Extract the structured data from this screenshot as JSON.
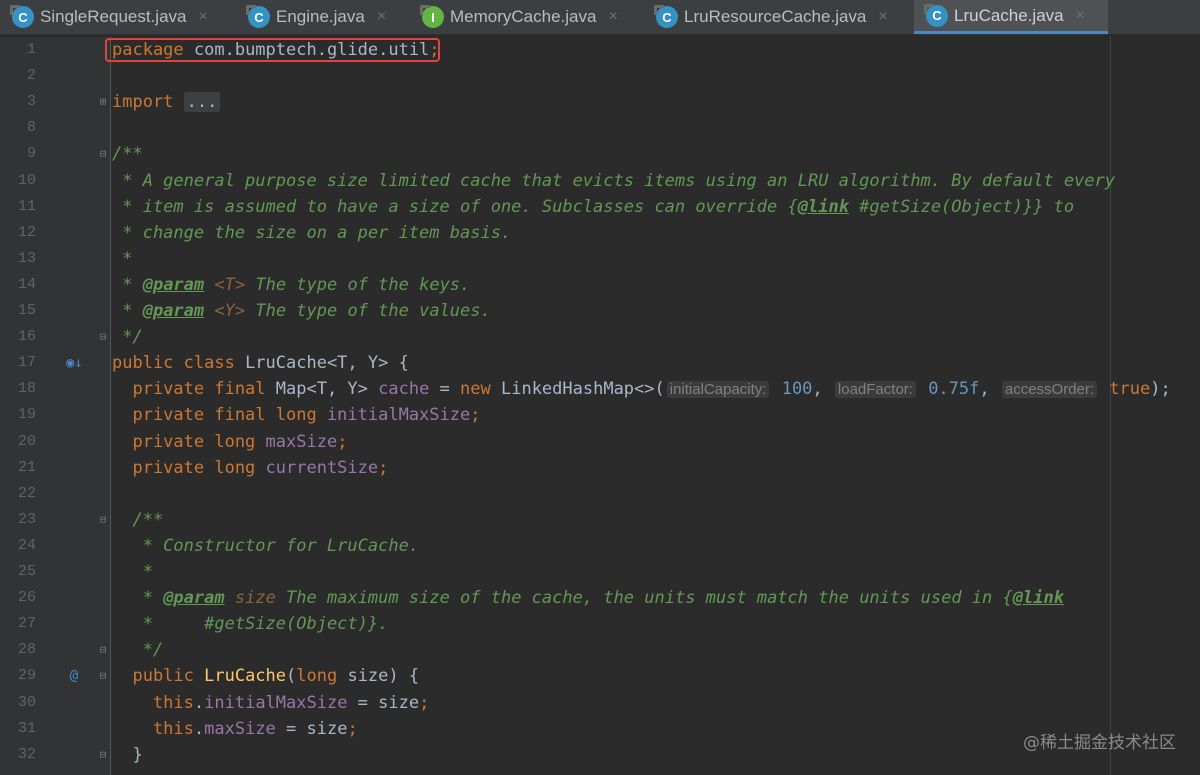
{
  "tabs": [
    {
      "label": "SingleRequest.java",
      "icon": "class-c-icon",
      "badge": "C",
      "active": false
    },
    {
      "label": "Engine.java",
      "icon": "class-c-icon",
      "badge": "C",
      "active": false
    },
    {
      "label": "MemoryCache.java",
      "icon": "interface-i-icon",
      "badge": "I",
      "active": false
    },
    {
      "label": "LruResourceCache.java",
      "icon": "class-c-icon",
      "badge": "C",
      "active": false
    },
    {
      "label": "LruCache.java",
      "icon": "class-c-icon",
      "badge": "C",
      "active": true
    }
  ],
  "close_glyph": "×",
  "editor": {
    "lines": [
      {
        "n": "1",
        "tokens": [
          [
            "kw",
            "package"
          ],
          [
            "id",
            " com.bumptech.glide.util"
          ],
          [
            "kw",
            ";"
          ]
        ]
      },
      {
        "n": "2",
        "tokens": []
      },
      {
        "n": "3",
        "fold": "⊞",
        "tokens": [
          [
            "kw",
            "import"
          ],
          [
            "id",
            " "
          ],
          [
            "folded",
            "..."
          ]
        ]
      },
      {
        "n": "8",
        "tokens": []
      },
      {
        "n": "9",
        "fold": "⊟",
        "tokens": [
          [
            "doc",
            "/**"
          ]
        ]
      },
      {
        "n": "10",
        "tokens": [
          [
            "doc",
            " * A general purpose size limited cache that evicts items using an LRU algorithm. By default every"
          ]
        ]
      },
      {
        "n": "11",
        "tokens": [
          [
            "doc",
            " * item is assumed to have a size of one. Subclasses can override {"
          ],
          [
            "tag",
            "@link"
          ],
          [
            "doc",
            " #getSize("
          ],
          [
            "docref",
            "Object"
          ],
          [
            "doc",
            ")}} to"
          ]
        ]
      },
      {
        "n": "12",
        "tokens": [
          [
            "doc",
            " * change the size on a per item basis."
          ]
        ]
      },
      {
        "n": "13",
        "tokens": [
          [
            "doc",
            " *"
          ]
        ]
      },
      {
        "n": "14",
        "tokens": [
          [
            "doc",
            " * "
          ],
          [
            "tag",
            "@param"
          ],
          [
            "doc",
            " "
          ],
          [
            "tparam",
            "<T>"
          ],
          [
            "doc",
            " The type of the keys."
          ]
        ]
      },
      {
        "n": "15",
        "tokens": [
          [
            "doc",
            " * "
          ],
          [
            "tag",
            "@param"
          ],
          [
            "doc",
            " "
          ],
          [
            "tparam",
            "<Y>"
          ],
          [
            "doc",
            " The type of the values."
          ]
        ]
      },
      {
        "n": "16",
        "fold": "⊟",
        "tokens": [
          [
            "doc",
            " */"
          ]
        ]
      },
      {
        "n": "17",
        "gutter": "◉↓",
        "gutter_name": "implemented-by-icon",
        "tokens": [
          [
            "kw",
            "public class "
          ],
          [
            "id",
            "LruCache<T, Y> {"
          ]
        ]
      },
      {
        "n": "18",
        "tokens": [
          [
            "kw",
            "  private final "
          ],
          [
            "id",
            "Map<T, Y> "
          ],
          [
            "field",
            "cache"
          ],
          [
            "id",
            " = "
          ],
          [
            "kw",
            "new "
          ],
          [
            "id",
            "LinkedHashMap<>("
          ],
          [
            "hint",
            "initialCapacity:"
          ],
          [
            "num",
            " 100"
          ],
          [
            "id",
            ", "
          ],
          [
            "hint",
            "loadFactor:"
          ],
          [
            "num",
            " 0.75f"
          ],
          [
            "id",
            ", "
          ],
          [
            "hint",
            "accessOrder:"
          ],
          [
            "kw",
            " true"
          ],
          [
            "id",
            ");"
          ]
        ]
      },
      {
        "n": "19",
        "tokens": [
          [
            "kw",
            "  private final long "
          ],
          [
            "field",
            "initialMaxSize"
          ],
          [
            "kw",
            ";"
          ]
        ]
      },
      {
        "n": "20",
        "tokens": [
          [
            "kw",
            "  private long "
          ],
          [
            "field",
            "maxSize"
          ],
          [
            "kw",
            ";"
          ]
        ]
      },
      {
        "n": "21",
        "tokens": [
          [
            "kw",
            "  private long "
          ],
          [
            "field",
            "currentSize"
          ],
          [
            "kw",
            ";"
          ]
        ]
      },
      {
        "n": "22",
        "tokens": []
      },
      {
        "n": "23",
        "fold": "⊟",
        "tokens": [
          [
            "doc",
            "  /**"
          ]
        ]
      },
      {
        "n": "24",
        "tokens": [
          [
            "doc",
            "   * Constructor for LruCache."
          ]
        ]
      },
      {
        "n": "25",
        "tokens": [
          [
            "doc",
            "   *"
          ]
        ]
      },
      {
        "n": "26",
        "tokens": [
          [
            "doc",
            "   * "
          ],
          [
            "tag",
            "@param"
          ],
          [
            "doc",
            " "
          ],
          [
            "tparam",
            "size"
          ],
          [
            "doc",
            " The maximum size of the cache, the units must match the units used in {"
          ],
          [
            "tag",
            "@link"
          ]
        ]
      },
      {
        "n": "27",
        "tokens": [
          [
            "doc",
            "   *     #getSize("
          ],
          [
            "docref",
            "Object"
          ],
          [
            "doc",
            ")}."
          ]
        ]
      },
      {
        "n": "28",
        "fold": "⊟",
        "tokens": [
          [
            "doc",
            "   */"
          ]
        ]
      },
      {
        "n": "29",
        "gutter": "@",
        "gutter_name": "annotation-icon",
        "fold": "⊟",
        "tokens": [
          [
            "kw",
            "  public "
          ],
          [
            "fn",
            "LruCache"
          ],
          [
            "id",
            "("
          ],
          [
            "kw",
            "long "
          ],
          [
            "id",
            "size) {"
          ]
        ]
      },
      {
        "n": "30",
        "tokens": [
          [
            "kw",
            "    this"
          ],
          [
            "id",
            "."
          ],
          [
            "field",
            "initialMaxSize"
          ],
          [
            "id",
            " = size"
          ],
          [
            "kw",
            ";"
          ]
        ]
      },
      {
        "n": "31",
        "tokens": [
          [
            "kw",
            "    this"
          ],
          [
            "id",
            "."
          ],
          [
            "field",
            "maxSize"
          ],
          [
            "id",
            " = size"
          ],
          [
            "kw",
            ";"
          ]
        ]
      },
      {
        "n": "32",
        "fold": "⊟",
        "tokens": [
          [
            "id",
            "  }"
          ]
        ]
      }
    ]
  },
  "watermark": "@稀土掘金技术社区",
  "colors": {
    "background": "#2b2b2b",
    "keyword": "#cc7832",
    "doc_comment": "#629755",
    "field": "#9876aa",
    "number": "#6897bb",
    "method": "#ffc66d",
    "highlight_box": "#e0443e",
    "active_tab_underline": "#4a88c7"
  }
}
